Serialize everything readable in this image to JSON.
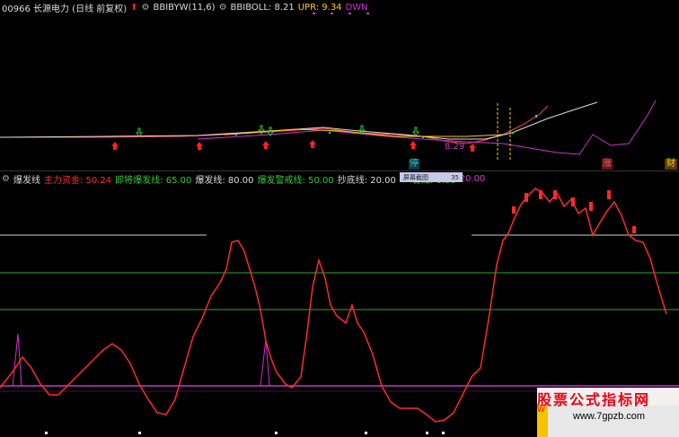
{
  "header": {
    "code_name": "00966 长源电力 (日线 前复权)",
    "bbiyw": "BBIBYW(11,6)",
    "bbiboll_label": "BBIBOLL: 8.21",
    "upr_label": "UPR: 9.34",
    "dwn_label": "DWN"
  },
  "price_panel": {
    "price_label": "8.29",
    "badges": [
      "停",
      "涨",
      "财"
    ]
  },
  "indicator_header": {
    "name": "爆发线",
    "items": [
      {
        "label": "主力资金: 50.24",
        "color": "#ff3030"
      },
      {
        "label": "即将爆发线: 65.00",
        "color": "#33cc33"
      },
      {
        "label": "爆发线: 80.00",
        "color": "#dddddd"
      },
      {
        "label": "爆发警戒线: 50.00",
        "color": "#33cc33"
      },
      {
        "label": "抄底线: 20.00",
        "color": "#dddddd"
      },
      {
        "label": "合威: 0.00",
        "color": "#33cc33"
      },
      {
        "label": "20.00",
        "color": "#cc44cc"
      }
    ]
  },
  "screenshot_button": {
    "label": "屏幕截图",
    "num": "35"
  },
  "watermark": {
    "site": "www.7gpzb.com"
  },
  "colors": {
    "main_line": "#ff2a2a",
    "green_line": "#2ea82e",
    "white_line": "#d0d0d0",
    "magenta": "#cc33cc"
  }
}
